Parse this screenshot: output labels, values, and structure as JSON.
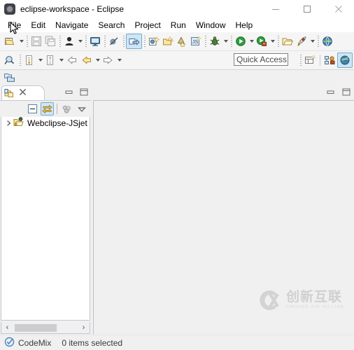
{
  "window": {
    "title": "eclipse-workspace - Eclipse",
    "app_icon": "eclipse-icon",
    "controls": {
      "minimize": "minimize-icon",
      "maximize": "maximize-icon",
      "close": "close-icon"
    }
  },
  "menubar": {
    "items": [
      {
        "label": "File"
      },
      {
        "label": "Edit"
      },
      {
        "label": "Navigate"
      },
      {
        "label": "Search"
      },
      {
        "label": "Project"
      },
      {
        "label": "Run"
      },
      {
        "label": "Window"
      },
      {
        "label": "Help"
      }
    ]
  },
  "toolbar_row1": {
    "items": [
      {
        "name": "new-wizard-button",
        "icon": "new-file-icon",
        "dropdown": true,
        "selected": false
      },
      {
        "name": "save-button",
        "icon": "save-icon",
        "dropdown": false,
        "selected": false
      },
      {
        "name": "save-all-button",
        "icon": "save-all-icon",
        "dropdown": false,
        "selected": false
      },
      {
        "name": "open-type-button",
        "icon": "person-icon",
        "dropdown": true,
        "selected": false
      },
      {
        "name": "terminal-button",
        "icon": "monitor-icon",
        "dropdown": false,
        "selected": false
      },
      {
        "name": "skip-breakpoints-button",
        "icon": "breakpoint-skip-icon",
        "dropdown": false,
        "selected": false
      },
      {
        "name": "open-resource-button",
        "icon": "open-arrow-icon",
        "dropdown": false,
        "selected": true
      },
      {
        "name": "new-java-class-button",
        "icon": "new-class-icon",
        "dropdown": false,
        "selected": false
      },
      {
        "name": "new-package-button",
        "icon": "new-package-icon",
        "dropdown": false,
        "selected": false
      },
      {
        "name": "new-annotation-button",
        "icon": "new-annotation-icon",
        "dropdown": false,
        "selected": false
      },
      {
        "name": "new-js-file-button",
        "icon": "new-js-icon",
        "dropdown": false,
        "selected": false
      },
      {
        "name": "debug-button",
        "icon": "debug-bug-icon",
        "dropdown": true,
        "selected": false
      },
      {
        "name": "run-button",
        "icon": "run-play-icon",
        "dropdown": true,
        "selected": false
      },
      {
        "name": "run-server-button",
        "icon": "run-server-icon",
        "dropdown": true,
        "selected": false
      },
      {
        "name": "open-perspective-button",
        "icon": "open-folder-icon",
        "dropdown": false,
        "selected": false
      },
      {
        "name": "external-tools-button",
        "icon": "external-tools-icon",
        "dropdown": true,
        "selected": false
      },
      {
        "name": "web-browser-button",
        "icon": "globe-icon",
        "dropdown": false,
        "selected": false
      }
    ]
  },
  "toolbar_row2": {
    "items": [
      {
        "name": "search-button",
        "icon": "search-magnifier-icon",
        "dropdown": false
      },
      {
        "name": "next-annotation-button",
        "icon": "next-annotation-icon",
        "dropdown": true
      },
      {
        "name": "previous-annotation-button",
        "icon": "previous-annotation-icon",
        "dropdown": true
      },
      {
        "name": "last-edit-location-button",
        "icon": "last-edit-arrow-icon",
        "dropdown": false
      },
      {
        "name": "back-button",
        "icon": "back-arrow-icon",
        "dropdown": true
      },
      {
        "name": "forward-button",
        "icon": "forward-arrow-icon",
        "dropdown": true
      }
    ],
    "quick_access": {
      "name": "quick-access-field",
      "value": "Quick Access",
      "placeholder": "Quick Access"
    },
    "perspective_buttons": [
      {
        "name": "open-perspective-button",
        "icon": "open-perspective-icon"
      },
      {
        "name": "perspective-java-ee",
        "icon": "java-ee-perspective-icon"
      },
      {
        "name": "perspective-codemix",
        "icon": "codemix-perspective-icon",
        "selected": true
      }
    ]
  },
  "left_view": {
    "tab": {
      "name": "project-explorer-tab",
      "icon": "project-explorer-icon",
      "close_icon": "close-icon",
      "label": ""
    },
    "minimize_icon": "minimize-view-icon",
    "maximize_icon": "maximize-view-icon",
    "toolbar": [
      {
        "name": "collapse-all-button",
        "icon": "collapse-all-icon",
        "selected": false
      },
      {
        "name": "link-with-editor-button",
        "icon": "link-with-editor-icon",
        "selected": true
      },
      {
        "name": "view-filters-button",
        "icon": "filters-icon",
        "selected": false
      },
      {
        "name": "view-menu-button",
        "icon": "view-menu-chevron-icon",
        "selected": false
      }
    ],
    "tree": [
      {
        "name": "tree-item-project",
        "label": "Webclipse-JSjet",
        "twisty": "chevron-right-icon",
        "icon": "java-project-icon",
        "expanded": false
      }
    ],
    "hscroll": {
      "left_arrow": "scroll-left-icon",
      "right_arrow": "scroll-right-icon"
    }
  },
  "editor_area": {
    "minimize_icon": "minimize-editor-icon",
    "maximize_icon": "maximize-editor-icon",
    "empty": true
  },
  "statusbar": {
    "brand_icon": "codemix-check-icon",
    "brand_label": "CodeMix",
    "selection_label": "0 items selected"
  },
  "watermark": {
    "logo": "cx-logo-icon",
    "chinese": "创新互联",
    "pinyin": "CHUANG XIN HU LIAN"
  },
  "cursor": {
    "name": "mouse-cursor",
    "icon": "arrow-pointer-icon"
  },
  "colors": {
    "titlebar_bg": "#ffffff",
    "toolbar_bg": "#f5f5f5",
    "workbench_bg": "#f0f0f0",
    "selected_tool_bg": "#cde6f7",
    "selected_tool_border": "#7aa8c8",
    "tab_border": "#c3c9cf",
    "text": "#000000"
  }
}
